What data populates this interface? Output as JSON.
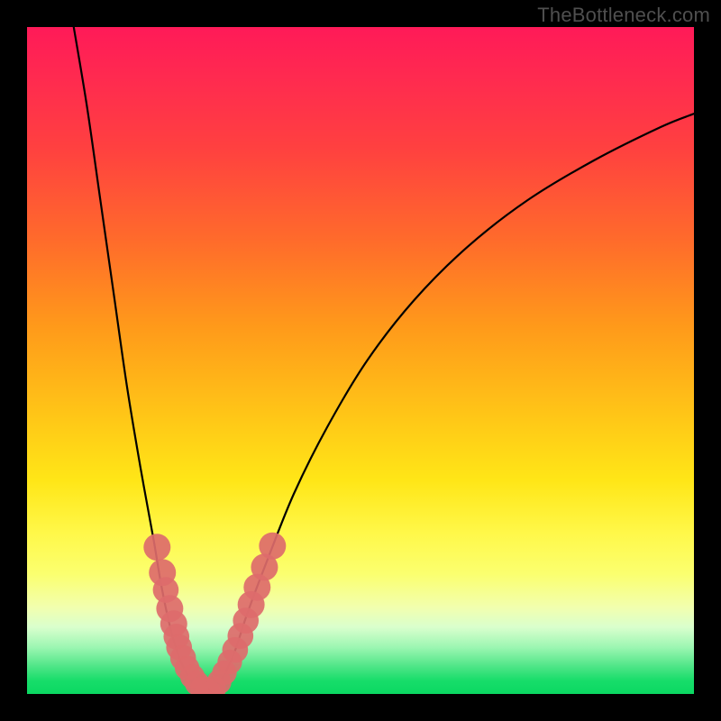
{
  "watermark": "TheBottleneck.com",
  "chart_data": {
    "type": "line",
    "title": "",
    "xlabel": "",
    "ylabel": "",
    "xlim": [
      0,
      100
    ],
    "ylim": [
      0,
      100
    ],
    "grid": false,
    "curves": {
      "left": [
        {
          "x": 7,
          "y": 100
        },
        {
          "x": 9,
          "y": 88
        },
        {
          "x": 11,
          "y": 74
        },
        {
          "x": 13,
          "y": 60
        },
        {
          "x": 15,
          "y": 46
        },
        {
          "x": 17,
          "y": 34
        },
        {
          "x": 19,
          "y": 23
        },
        {
          "x": 20,
          "y": 17
        },
        {
          "x": 21,
          "y": 12
        },
        {
          "x": 22,
          "y": 8
        },
        {
          "x": 23,
          "y": 5
        },
        {
          "x": 24,
          "y": 3
        },
        {
          "x": 25,
          "y": 1.5
        },
        {
          "x": 26,
          "y": 0.7
        },
        {
          "x": 27,
          "y": 0.3
        }
      ],
      "right": [
        {
          "x": 27,
          "y": 0.3
        },
        {
          "x": 29,
          "y": 2
        },
        {
          "x": 31,
          "y": 6
        },
        {
          "x": 33,
          "y": 12
        },
        {
          "x": 36,
          "y": 20
        },
        {
          "x": 40,
          "y": 30
        },
        {
          "x": 45,
          "y": 40
        },
        {
          "x": 51,
          "y": 50
        },
        {
          "x": 58,
          "y": 59
        },
        {
          "x": 66,
          "y": 67
        },
        {
          "x": 75,
          "y": 74
        },
        {
          "x": 85,
          "y": 80
        },
        {
          "x": 95,
          "y": 85
        },
        {
          "x": 100,
          "y": 87
        }
      ]
    },
    "beads": [
      {
        "x": 19.5,
        "y": 22,
        "r": 1.5
      },
      {
        "x": 20.3,
        "y": 18.2,
        "r": 1.5
      },
      {
        "x": 20.8,
        "y": 15.6,
        "r": 1.4
      },
      {
        "x": 21.4,
        "y": 12.8,
        "r": 1.5
      },
      {
        "x": 22.0,
        "y": 10.5,
        "r": 1.5
      },
      {
        "x": 22.4,
        "y": 8.6,
        "r": 1.4
      },
      {
        "x": 22.8,
        "y": 7.0,
        "r": 1.4
      },
      {
        "x": 23.4,
        "y": 5.4,
        "r": 1.4
      },
      {
        "x": 24.0,
        "y": 3.9,
        "r": 1.3
      },
      {
        "x": 24.8,
        "y": 2.6,
        "r": 1.3
      },
      {
        "x": 25.5,
        "y": 1.6,
        "r": 1.3
      },
      {
        "x": 26.3,
        "y": 0.8,
        "r": 1.3
      },
      {
        "x": 27.1,
        "y": 0.4,
        "r": 1.3
      },
      {
        "x": 28.0,
        "y": 0.8,
        "r": 1.3
      },
      {
        "x": 28.8,
        "y": 1.8,
        "r": 1.3
      },
      {
        "x": 29.6,
        "y": 3.2,
        "r": 1.3
      },
      {
        "x": 30.4,
        "y": 4.8,
        "r": 1.3
      },
      {
        "x": 31.2,
        "y": 6.6,
        "r": 1.4
      },
      {
        "x": 32.0,
        "y": 8.7,
        "r": 1.4
      },
      {
        "x": 32.8,
        "y": 11.0,
        "r": 1.4
      },
      {
        "x": 33.6,
        "y": 13.4,
        "r": 1.5
      },
      {
        "x": 34.5,
        "y": 16.0,
        "r": 1.5
      },
      {
        "x": 35.6,
        "y": 19.0,
        "r": 1.5
      },
      {
        "x": 36.8,
        "y": 22.2,
        "r": 1.5
      }
    ]
  }
}
